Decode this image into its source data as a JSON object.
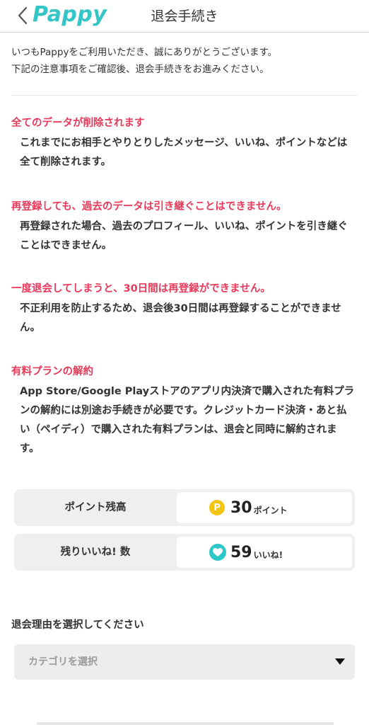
{
  "header": {
    "back_icon": "chevron-left-icon",
    "logo": "Pappy",
    "title": "退会手続き",
    "accent_color": "#34c6c6"
  },
  "intro": {
    "line1": "いつもPappyをご利用いただき、誠にありがとうございます。",
    "line2": "下記の注意事項をご確認後、退会手続きをお進みください。"
  },
  "notices": [
    {
      "title": "全てのデータが削除されます",
      "body": "これまでにお相手とやりとりしたメッセージ、いいね、ポイントなどは全て削除されます。"
    },
    {
      "title": "再登録しても、過去のデータは引き継ぐことはできません。",
      "body": "再登録された場合、過去のプロフィール、いいね、ポイントを引き継ぐことはできません。"
    },
    {
      "title": "一度退会してしまうと、30日間は再登録ができません。",
      "body": "不正利用を防止するため、退会後30日間は再登録することができません。"
    },
    {
      "title": "有料プランの解約",
      "body": "App Store/Google Playストアのアプリ内決済で購入された有料プランの解約には別途お手続きが必要です。クレジットカード決済・あと払い（ペイディ）で購入された有料プランは、退会と同時に解約されます。"
    }
  ],
  "stats": {
    "points": {
      "label": "ポイント残高",
      "icon": "coin-icon",
      "icon_glyph": "P",
      "value": "30",
      "unit": "ポイント"
    },
    "likes": {
      "label": "残りいいね! 数",
      "icon": "heart-icon",
      "value": "59",
      "unit": "いいね!"
    }
  },
  "reason": {
    "label": "退会理由を選択してください",
    "placeholder": "カテゴリを選択"
  },
  "colors": {
    "warning": "#e83a5a",
    "coin": "#f5c514",
    "heart": "#2ec7c7"
  }
}
